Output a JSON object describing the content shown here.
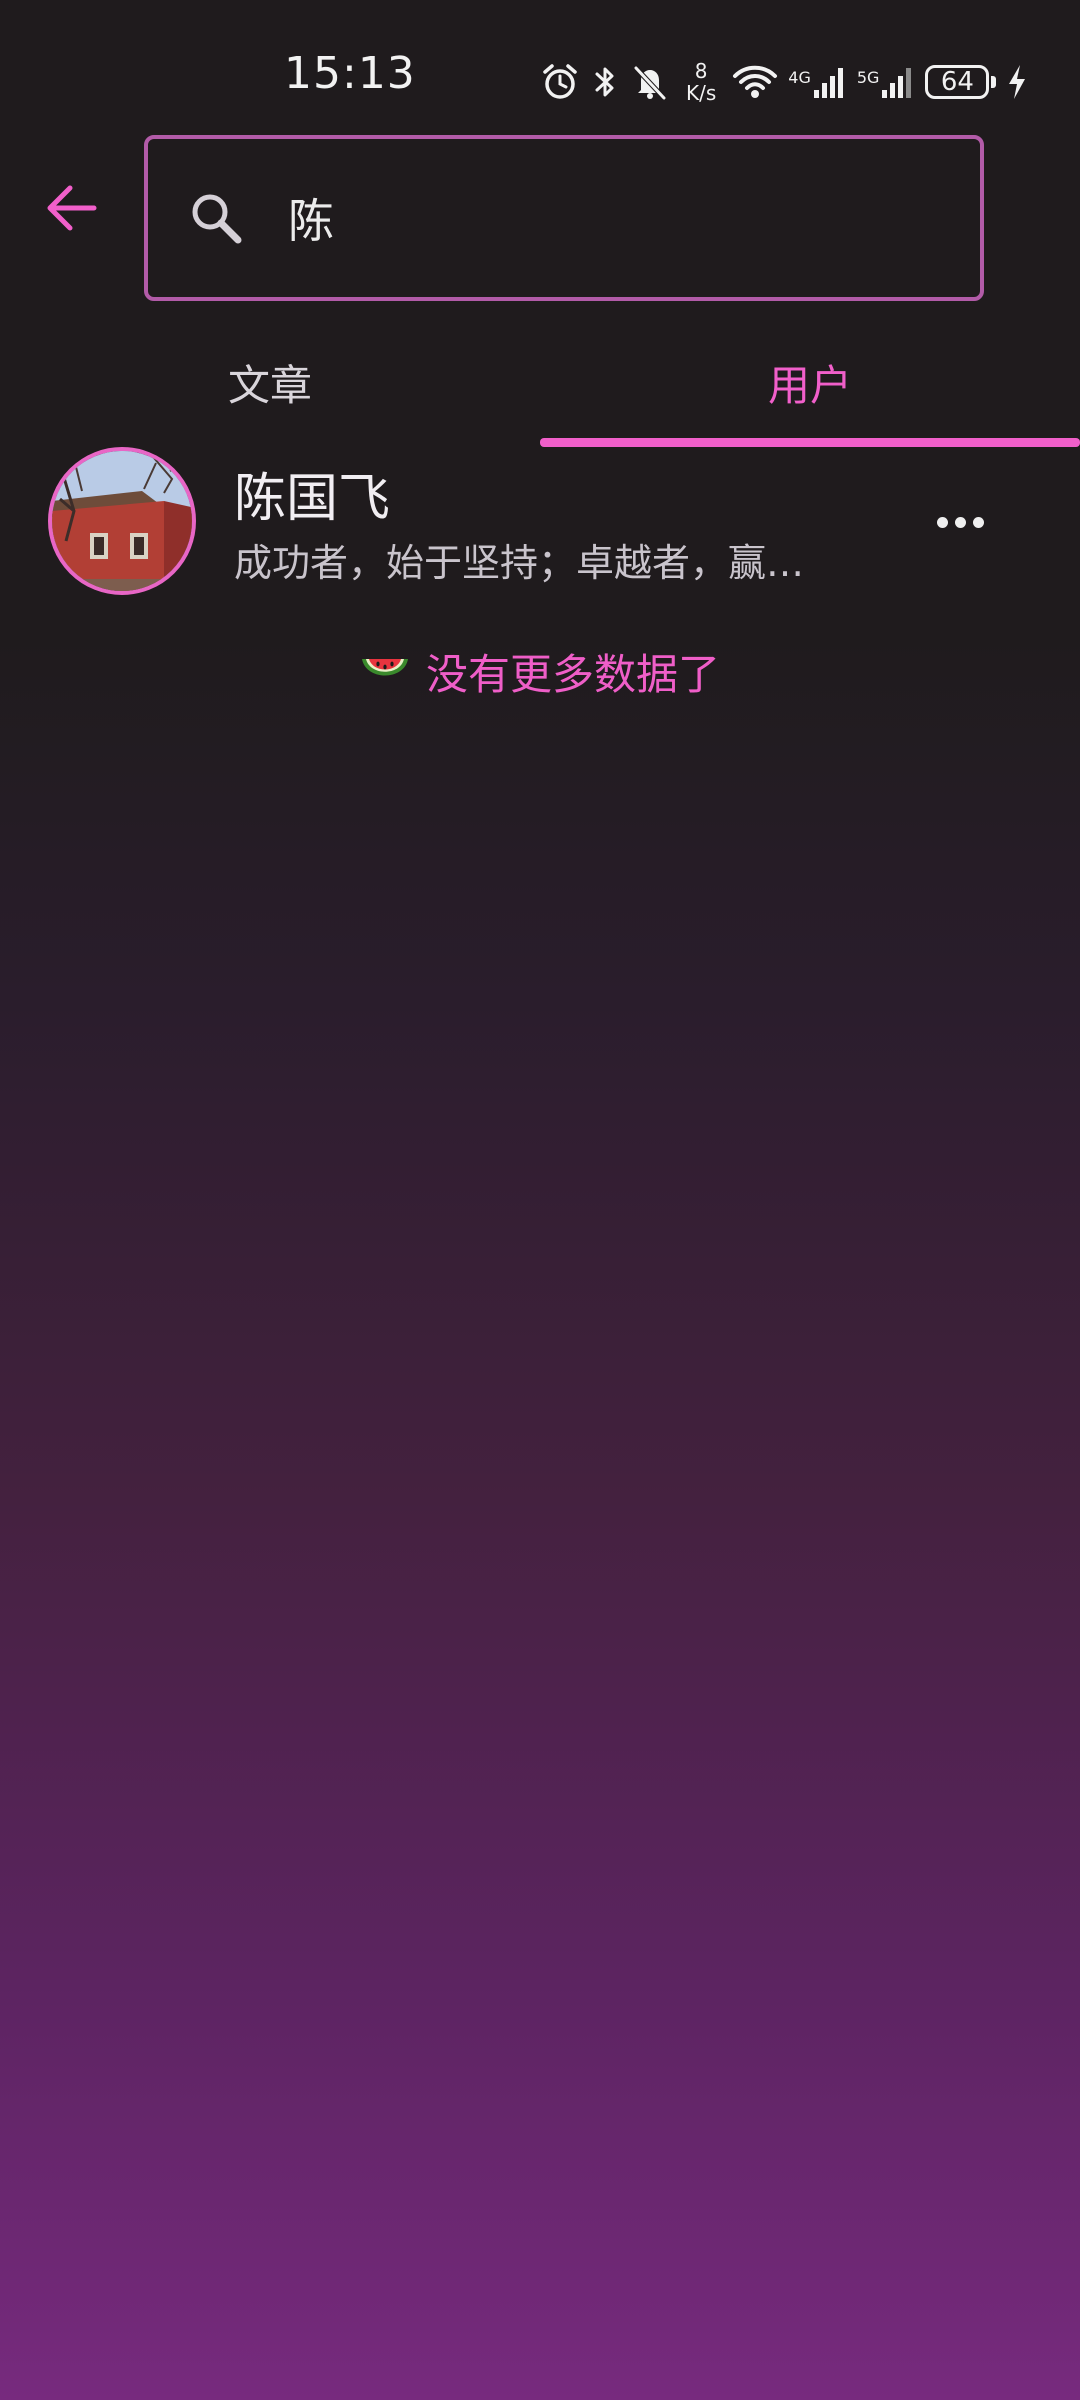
{
  "status_bar": {
    "time": "15:13",
    "net_speed_value": "8",
    "net_speed_unit": "K/s",
    "signal1_label": "4G",
    "signal2_label": "5G",
    "battery": "64",
    "icons": [
      "alarm-icon",
      "bluetooth-icon",
      "mute-icon",
      "wifi-icon",
      "signal-icon",
      "signal-icon",
      "battery-icon",
      "charging-icon"
    ]
  },
  "search": {
    "value": "陈",
    "back_icon": "arrow-left-icon",
    "search_icon": "search-icon"
  },
  "tabs": [
    {
      "label": "文章",
      "active": false
    },
    {
      "label": "用户",
      "active": true
    }
  ],
  "results": [
    {
      "name": "陈国飞",
      "bio": "成功者，始于坚持；卓越者，赢…",
      "avatar_icon": "avatar-photo"
    }
  ],
  "end_message": "没有更多数据了",
  "end_icon": "watermelon-icon",
  "colors": {
    "accent": "#f15fca",
    "search_border": "#b25ba8",
    "background_top": "#1f1b1d",
    "background_bottom": "#772a7e"
  }
}
